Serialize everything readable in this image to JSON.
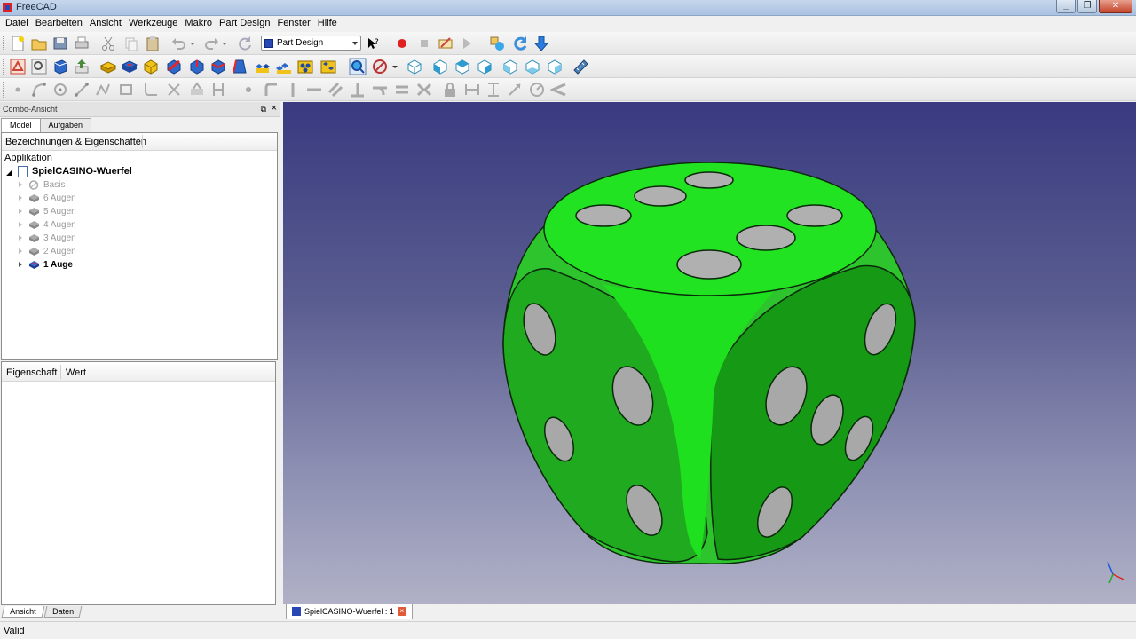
{
  "window": {
    "title": "FreeCAD"
  },
  "menu": [
    {
      "label": "Datei"
    },
    {
      "label": "Bearbeiten"
    },
    {
      "label": "Ansicht"
    },
    {
      "label": "Werkzeuge"
    },
    {
      "label": "Makro"
    },
    {
      "label": "Part Design"
    },
    {
      "label": "Fenster"
    },
    {
      "label": "Hilfe"
    }
  ],
  "toolbar": {
    "workbench": "Part Design"
  },
  "combo": {
    "title": "Combo-Ansicht",
    "tabs": [
      "Model",
      "Aufgaben"
    ],
    "tree_header": "Bezeichnungen & Eigenschaften",
    "root": "Applikation",
    "document": "SpielCASINO-Wuerfel",
    "features": [
      {
        "label": "Basis"
      },
      {
        "label": "6 Augen"
      },
      {
        "label": "5 Augen"
      },
      {
        "label": "4 Augen"
      },
      {
        "label": "3 Augen"
      },
      {
        "label": "2 Augen"
      },
      {
        "label": "1 Auge"
      }
    ],
    "property_columns": [
      "Eigenschaft",
      "Wert"
    ],
    "bottom_tabs": [
      "Ansicht",
      "Daten"
    ]
  },
  "view": {
    "tab_label": "SpielCASINO-Wuerfel : 1",
    "dice_color": "#1fd81f"
  },
  "status": {
    "text": "Valid"
  }
}
